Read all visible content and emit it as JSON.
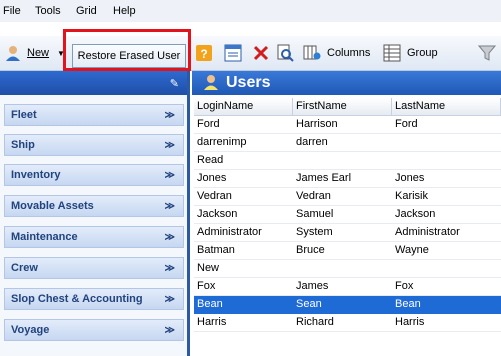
{
  "menu": [
    "File",
    "Tools",
    "Grid",
    "Help"
  ],
  "toolbar": {
    "new_label": "New",
    "restore_label": "Restore Erased User",
    "columns_label": "Columns",
    "group_label": "Group"
  },
  "nav": {
    "items": [
      {
        "label": "Fleet"
      },
      {
        "label": "Ship"
      },
      {
        "label": "Inventory"
      },
      {
        "label": "Movable Assets"
      },
      {
        "label": "Maintenance"
      },
      {
        "label": "Crew"
      },
      {
        "label": "Slop Chest & Accounting"
      },
      {
        "label": "Voyage"
      }
    ]
  },
  "users": {
    "title": "Users",
    "columns": [
      "LoginName",
      "FirstName",
      "LastName"
    ],
    "rows": [
      [
        "Ford",
        "Harrison",
        "Ford"
      ],
      [
        "darrenimp",
        "darren",
        ""
      ],
      [
        "Read",
        "",
        ""
      ],
      [
        "Jones",
        "James Earl",
        "Jones"
      ],
      [
        "Vedran",
        "Vedran",
        "Karisik"
      ],
      [
        "Jackson",
        "Samuel",
        "Jackson"
      ],
      [
        "Administrator",
        "System",
        "Administrator"
      ],
      [
        "Batman",
        "Bruce",
        "Wayne"
      ],
      [
        "New",
        "",
        ""
      ],
      [
        "Fox",
        "James",
        "Fox"
      ],
      [
        "Bean",
        "Sean",
        "Bean"
      ],
      [
        "Harris",
        "Richard",
        "Harris"
      ]
    ],
    "selected_row": 10
  },
  "colors": {
    "highlight": "#e3131b",
    "header_blue": "#1f58b5",
    "selection": "#1f6bd6"
  }
}
